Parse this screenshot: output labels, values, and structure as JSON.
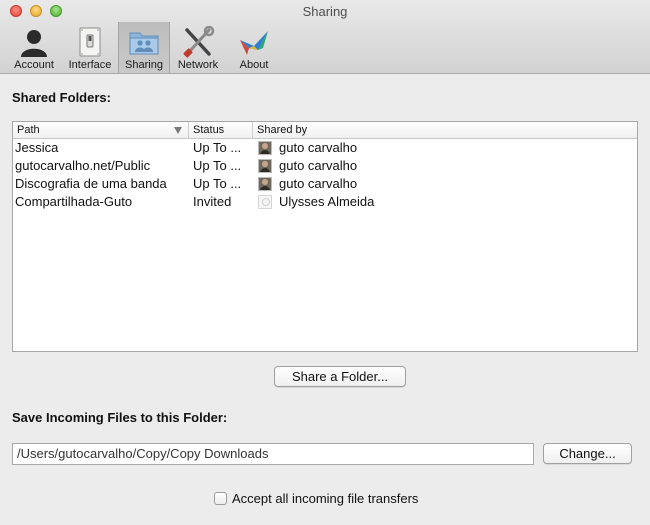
{
  "window": {
    "title": "Sharing"
  },
  "toolbar": {
    "items": [
      {
        "label": "Account",
        "icon": "account-icon"
      },
      {
        "label": "Interface",
        "icon": "interface-switch-icon"
      },
      {
        "label": "Sharing",
        "icon": "shared-folder-icon",
        "selected": true
      },
      {
        "label": "Network",
        "icon": "network-tools-icon"
      },
      {
        "label": "About",
        "icon": "about-bird-icon"
      }
    ]
  },
  "shared_folders": {
    "heading": "Shared Folders:",
    "columns": [
      "Path",
      "Status",
      "Shared by"
    ],
    "rows": [
      {
        "path": "Jessica",
        "status": "Up To ...",
        "shared_by": "guto carvalho",
        "avatar": "photo"
      },
      {
        "path": "gutocarvalho.net/Public",
        "status": "Up To ...",
        "shared_by": "guto carvalho",
        "avatar": "photo"
      },
      {
        "path": "Discografia de uma banda",
        "status": "Up To ...",
        "shared_by": "guto carvalho",
        "avatar": "photo"
      },
      {
        "path": "Compartilhada-Guto",
        "status": "Invited",
        "shared_by": "Ulysses Almeida",
        "avatar": "blank"
      }
    ],
    "share_button": "Share a Folder..."
  },
  "incoming": {
    "heading": "Save Incoming Files to this Folder:",
    "path_value": "/Users/gutocarvalho/Copy/Copy Downloads",
    "change_button": "Change...",
    "accept_all_label": "Accept all incoming file transfers",
    "accept_all_checked": false
  }
}
